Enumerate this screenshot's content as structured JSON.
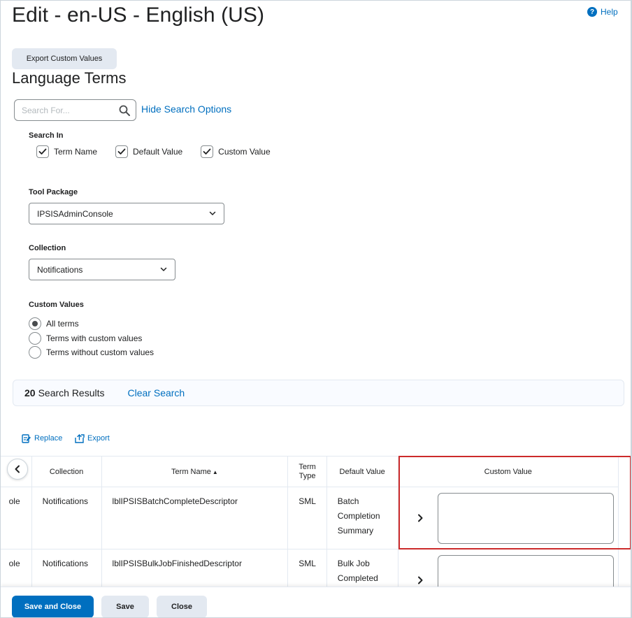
{
  "page": {
    "title": "Edit - en-US - English (US)",
    "help_label": "Help"
  },
  "toolbar": {
    "export_custom_values_label": "Export Custom Values"
  },
  "section": {
    "title": "Language Terms"
  },
  "search": {
    "placeholder": "Search For...",
    "value": "",
    "hide_options_label": "Hide Search Options"
  },
  "search_in": {
    "label": "Search In",
    "options": [
      {
        "label": "Term Name",
        "checked": true
      },
      {
        "label": "Default Value",
        "checked": true
      },
      {
        "label": "Custom Value",
        "checked": true
      }
    ]
  },
  "tool_package": {
    "label": "Tool Package",
    "selected": "IPSISAdminConsole"
  },
  "collection": {
    "label": "Collection",
    "selected": "Notifications"
  },
  "custom_values": {
    "label": "Custom Values",
    "options": [
      {
        "label": "All terms",
        "checked": true
      },
      {
        "label": "Terms with custom values",
        "checked": false
      },
      {
        "label": "Terms without custom values",
        "checked": false
      }
    ]
  },
  "results": {
    "count": "20",
    "text": "Search Results",
    "clear_label": "Clear Search"
  },
  "actions": {
    "replace_label": "Replace",
    "export_label": "Export"
  },
  "table": {
    "columns": {
      "tool_package": "",
      "collection": "Collection",
      "term_name": "Term Name",
      "term_type": "Term Type",
      "default_value": "Default Value",
      "custom_value": "Custom Value"
    },
    "sort_indicator": "▲",
    "rows": [
      {
        "tool_package": "ole",
        "collection": "Notifications",
        "term_name": "lblIPSISBatchCompleteDescriptor",
        "term_type": "SML",
        "default_value": "Batch Completion Summary",
        "custom_value": ""
      },
      {
        "tool_package": "ole",
        "collection": "Notifications",
        "term_name": "lblIPSISBulkJobFinishedDescriptor",
        "term_type": "SML",
        "default_value": "Bulk Job Completed",
        "custom_value": ""
      }
    ]
  },
  "footer": {
    "save_close_label": "Save and Close",
    "save_label": "Save",
    "close_label": "Close"
  },
  "colors": {
    "accent": "#006fbf",
    "highlight": "#cc2b2b",
    "secondary_button": "#e3e9f1"
  }
}
